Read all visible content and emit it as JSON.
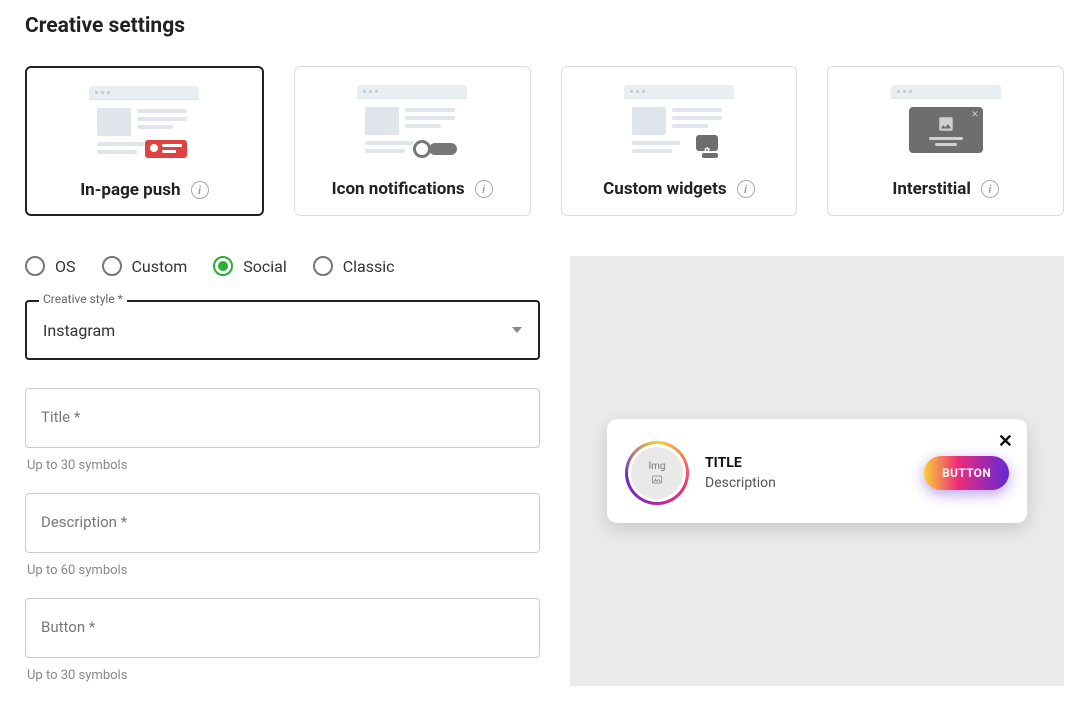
{
  "page": {
    "title": "Creative settings"
  },
  "formats": [
    {
      "label": "In-page push"
    },
    {
      "label": "Icon notifications"
    },
    {
      "label": "Custom widgets"
    },
    {
      "label": "Interstitial"
    }
  ],
  "radios": [
    {
      "label": "OS"
    },
    {
      "label": "Custom"
    },
    {
      "label": "Social"
    },
    {
      "label": "Classic"
    }
  ],
  "selected_radio": 2,
  "selected_format": 0,
  "style_select": {
    "label": "Creative style *",
    "value": "Instagram"
  },
  "title_input": {
    "label": "Title *",
    "helper": "Up to 30 symbols"
  },
  "desc_input": {
    "label": "Description *",
    "helper": "Up to 60 symbols"
  },
  "button_input": {
    "label": "Button *",
    "helper": "Up to 30 symbols"
  },
  "preview": {
    "img_placeholder": "Img",
    "title": "TITLE",
    "desc": "Description",
    "button": "BUTTON"
  }
}
